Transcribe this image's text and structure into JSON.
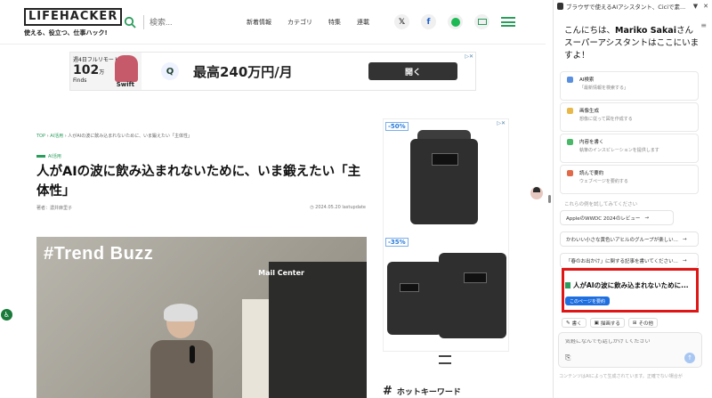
{
  "site": {
    "logo": "LIFEHACKER",
    "tagline": "使える、役立つ、仕事ハック!",
    "search_placeholder": "検索...",
    "nav": [
      "新着情報",
      "カテゴリ",
      "特集",
      "連載"
    ],
    "social": [
      "x-icon",
      "facebook-icon",
      "spotify-icon",
      "mail-icon"
    ],
    "top_ad": {
      "thumb_line1": "週4日フルリモート",
      "thumb_big": "102",
      "thumb_unit": "万",
      "thumb_brand": "Swift",
      "thumb_small": "Finds",
      "logo": "Q",
      "text": "最高240万円/月",
      "button": "開く"
    },
    "breadcrumb": {
      "home": "TOP",
      "sep": "›",
      "category": "AI活用",
      "current": "人がAIの波に飲み込まれないために、いま鍛えたい「主体性」"
    },
    "tag": "AI活用",
    "headline": "人がAIの波に飲み込まれないために、いま鍛えたい「主体性」",
    "author": "著者：濃井麻里子",
    "date": "2024.05.20 lastupdate",
    "hero_title": "#Trend Buzz",
    "hero_sign": "Mail Center",
    "side_ad": {
      "badge1": "-50%",
      "badge2": "-35%"
    },
    "hotkey": "ホットキーワード",
    "hotkey_symbol": "#"
  },
  "panel": {
    "header": "ブラウザで使えるAIアシスタント、Ciciで素...",
    "controls": [
      "pin-icon",
      "close-icon"
    ],
    "greeting_prefix": "こんにちは、",
    "user": "Mariko Sakai",
    "greeting_suffix": "さん",
    "greeting_line2": "スーパーアシスタントはここにいますよ！",
    "cards": [
      {
        "title": "AI検索",
        "desc": "「最新情報を検索する」",
        "color": "#5a8fe0"
      },
      {
        "title": "画像生成",
        "desc": "想像に従って図を作成する",
        "color": "#e8b84a"
      },
      {
        "title": "内容を書く",
        "desc": "執筆のインスピレーションを提供します",
        "color": "#4ab868"
      },
      {
        "title": "読んで要約",
        "desc": "ウェブページを要約する",
        "color": "#e06a4a"
      }
    ],
    "try_label": "これらの例を試してみてください",
    "suggestions": [
      "AppleのWWDC 2024のレビュー",
      "かわいい小さな黄色いアヒルのグループが楽しい...",
      "「春のお出かけ」に関する記事を書いてください..."
    ],
    "highlight_title": "人がAIの波に飲み込まれないために...",
    "highlight_button": "このページを要約",
    "tools": [
      "書く",
      "描画する",
      "その他"
    ],
    "input_placeholder": "気軽になんでも話しかけてください",
    "disclaimer": "コンテンツはAIによって生成されています。正確でない場合が"
  }
}
